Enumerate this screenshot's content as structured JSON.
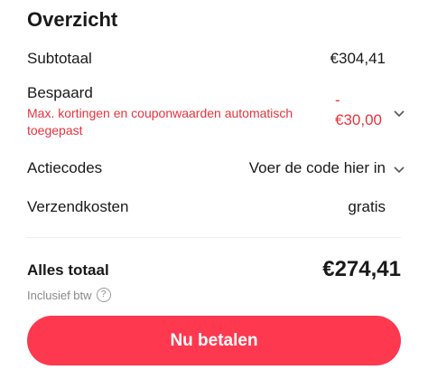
{
  "summary": {
    "title": "Overzicht",
    "subtotal_label": "Subtotaal",
    "subtotal_value": "€304,41",
    "saved_label": "Bespaard",
    "saved_description": "Max. kortingen en couponwaarden automatisch toegepast",
    "saved_value_sign": "-",
    "saved_value": "€30,00",
    "promo_label": "Actiecodes",
    "promo_placeholder": "Voer de code hier in",
    "shipping_label": "Verzendkosten",
    "shipping_value": "gratis",
    "total_label": "Alles totaal",
    "total_value": "€274,41",
    "vat_note": "Inclusief btw",
    "pay_button": "Nu betalen"
  },
  "colors": {
    "accent": "#fd384f",
    "discount": "#e8333d",
    "text": "#191919",
    "muted": "#888888"
  },
  "icons": {
    "chevron": "chevron-down-icon",
    "info": "info-icon"
  }
}
